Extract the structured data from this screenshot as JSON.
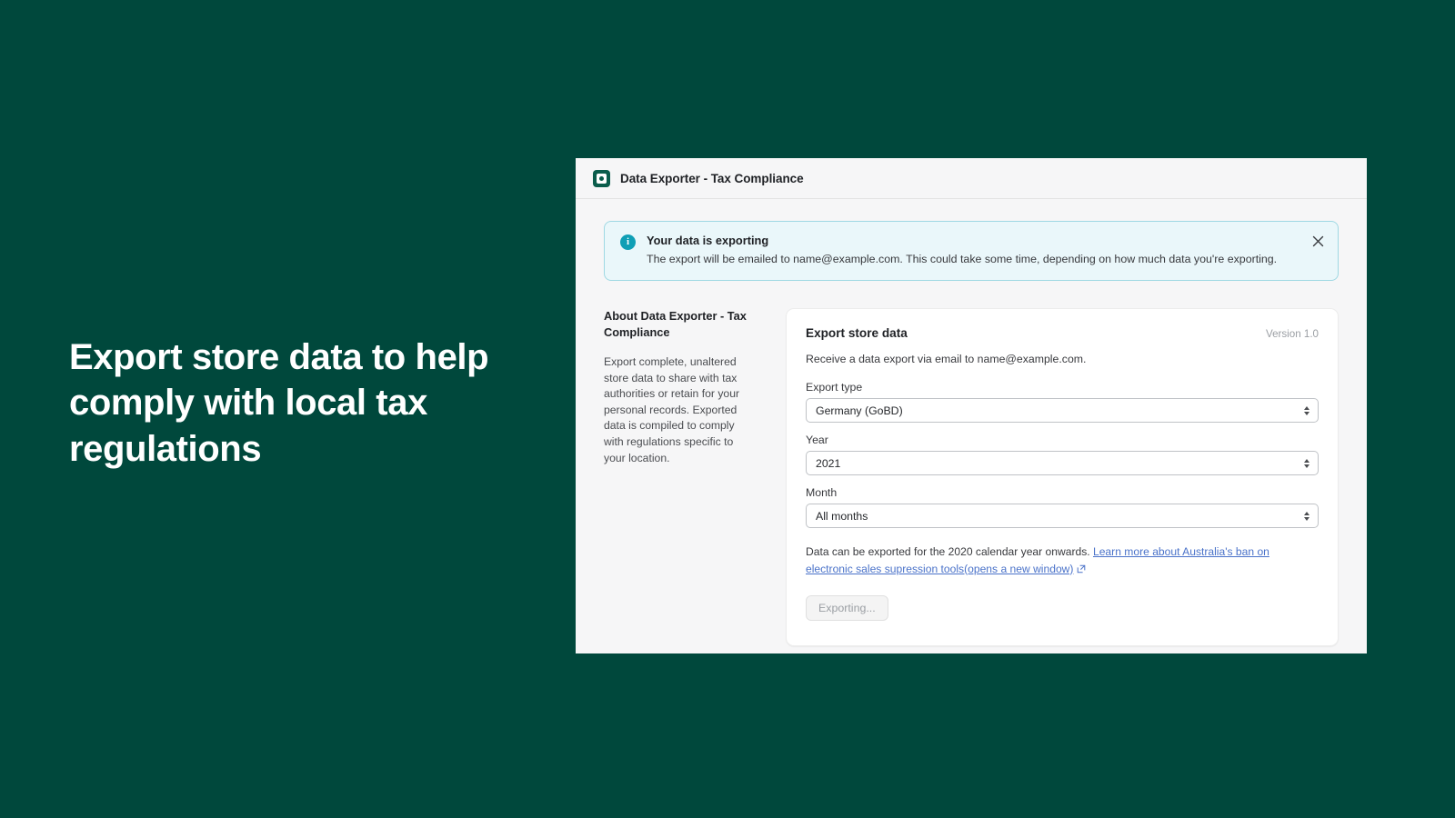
{
  "page": {
    "background_color": "#00483c",
    "headline": "Export store data to help comply with local tax regulations"
  },
  "window": {
    "app_icon_name": "data-exporter-app-icon",
    "title": "Data Exporter - Tax Compliance"
  },
  "banner": {
    "icon_name": "info-icon",
    "title": "Your data is exporting",
    "text": "The export will be emailed to name@example.com. This could take some time, depending on how much data you're exporting.",
    "close_label": "✕",
    "background_color": "#eaf7fa",
    "border_color": "#9fd8e3",
    "icon_color": "#0f9fb5"
  },
  "about": {
    "title": "About Data Exporter - Tax Compliance",
    "text": "Export complete, unaltered store data to share with tax authorities or retain for your personal records. Exported data is compiled to comply with regulations specific to your location."
  },
  "card": {
    "title": "Export store data",
    "version": "Version 1.0",
    "subtitle": "Receive a data export via email to name@example.com.",
    "fields": [
      {
        "label": "Export type",
        "value": "Germany (GoBD)"
      },
      {
        "label": "Year",
        "value": "2021"
      },
      {
        "label": "Month",
        "value": "All months"
      }
    ],
    "helper_prefix": "Data can be exported for the 2020 calendar year onwards. ",
    "helper_link": "Learn more about Australia's ban on electronic sales supression tools(opens a new window)",
    "helper_link_icon": "external-link-icon",
    "submit_label": "Exporting...",
    "link_color": "#4a72c9"
  }
}
